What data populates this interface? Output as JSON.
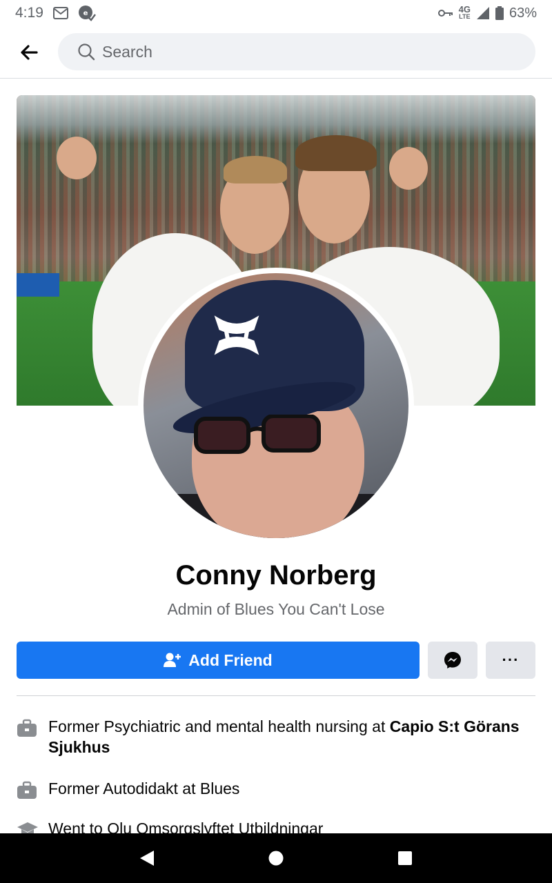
{
  "status_bar": {
    "time": "4:19",
    "network": "4G",
    "network_sub": "LTE",
    "battery": "63%"
  },
  "search": {
    "placeholder": "Search"
  },
  "profile": {
    "name": "Conny Norberg",
    "subtitle": "Admin of Blues You Can't Lose"
  },
  "actions": {
    "add_friend": "Add Friend",
    "more": "···"
  },
  "intro": [
    {
      "prefix": "Former Psychiatric and mental health nursing at ",
      "bold": "Capio S:t Görans Sjukhus",
      "icon": "briefcase-icon"
    },
    {
      "prefix": "Former Autodidakt at Blues",
      "bold": "",
      "icon": "briefcase-icon"
    },
    {
      "prefix": "Went to Olu Omsorgslyftet Utbildningar",
      "bold": "",
      "icon": "graduation-cap-icon"
    }
  ],
  "colors": {
    "primary": "#1877f2",
    "secondary_button": "#e4e6eb",
    "muted_text": "#65676b"
  }
}
